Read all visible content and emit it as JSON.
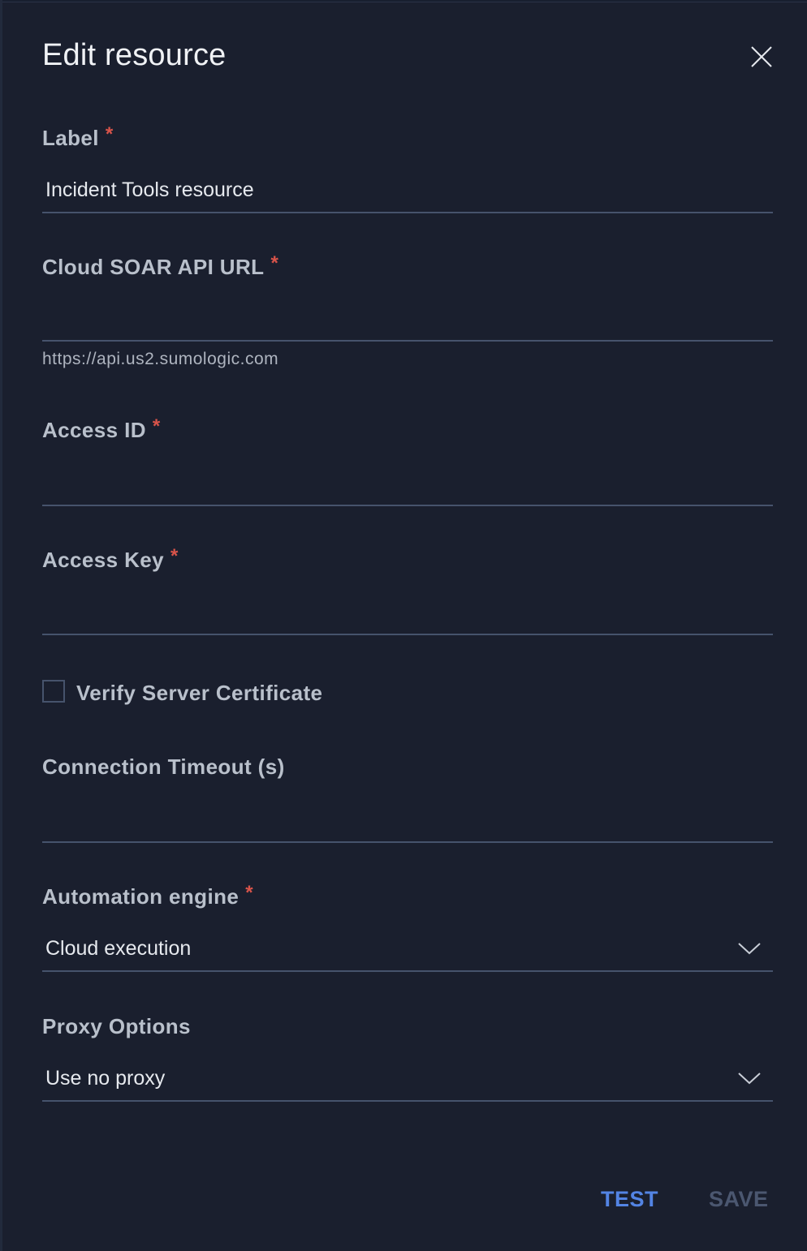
{
  "dialog": {
    "title": "Edit resource",
    "close_icon": "close-icon"
  },
  "fields": {
    "label": {
      "label": "Label",
      "required_marker": "*",
      "value": "Incident Tools resource"
    },
    "api_url": {
      "label": "Cloud SOAR API URL",
      "required_marker": "*",
      "value": "",
      "hint": "https://api.us2.sumologic.com"
    },
    "access_id": {
      "label": "Access ID",
      "required_marker": "*",
      "value": ""
    },
    "access_key": {
      "label": "Access Key",
      "required_marker": "*",
      "value": ""
    },
    "verify_cert": {
      "label": "Verify Server Certificate",
      "checked": false
    },
    "timeout": {
      "label": "Connection Timeout (s)",
      "value": ""
    },
    "automation_engine": {
      "label": "Automation engine",
      "required_marker": "*",
      "selected": "Cloud execution",
      "icon": "chevron-down-icon"
    },
    "proxy_options": {
      "label": "Proxy Options",
      "selected": "Use no proxy",
      "icon": "chevron-down-icon"
    }
  },
  "actions": {
    "test_label": "TEST",
    "save_label": "SAVE"
  },
  "colors": {
    "background": "#1a1f2e",
    "accent": "#5384e4",
    "required": "#d9544a",
    "disabled": "#4b5770",
    "underline": "#46536c"
  }
}
